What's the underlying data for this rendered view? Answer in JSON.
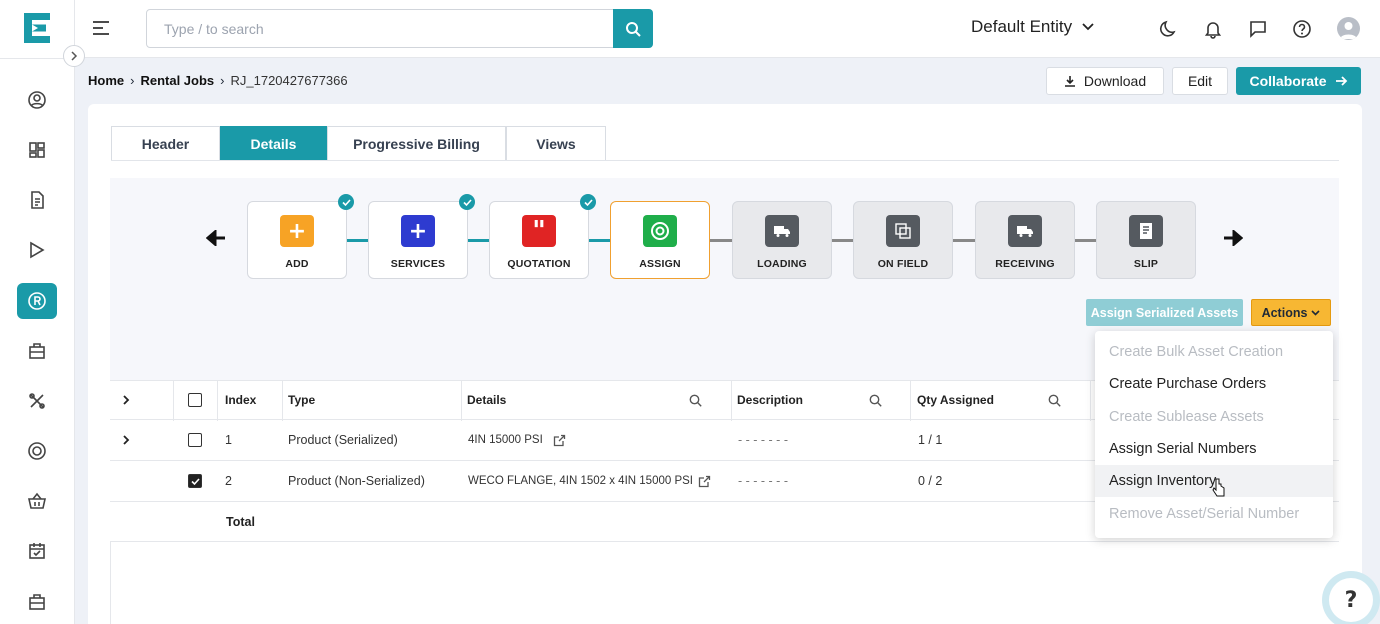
{
  "topbar": {
    "search_placeholder": "Type / to search",
    "entity": "Default Entity"
  },
  "breadcrumb": {
    "home": "Home",
    "section": "Rental Jobs",
    "current": "RJ_1720427677366"
  },
  "header_buttons": {
    "download": "Download",
    "edit": "Edit",
    "collaborate": "Collaborate"
  },
  "tabs": [
    {
      "label": "Header"
    },
    {
      "label": "Details"
    },
    {
      "label": "Progressive Billing"
    },
    {
      "label": "Views"
    }
  ],
  "workflow": {
    "steps": [
      {
        "label": "ADD",
        "state": "done",
        "icon": "plus-icon",
        "color": "#f7a325"
      },
      {
        "label": "SERVICES",
        "state": "done",
        "icon": "plus-icon",
        "color": "#2e3bd0"
      },
      {
        "label": "QUOTATION",
        "state": "done",
        "icon": "quote-icon",
        "color": "#e02424"
      },
      {
        "label": "ASSIGN",
        "state": "current",
        "icon": "assign-icon",
        "color": "#1fae4a"
      },
      {
        "label": "LOADING",
        "state": "pending",
        "icon": "truck-icon",
        "color": "#555a60"
      },
      {
        "label": "ON FIELD",
        "state": "pending",
        "icon": "field-icon",
        "color": "#555a60"
      },
      {
        "label": "RECEIVING",
        "state": "pending",
        "icon": "truck-icon",
        "color": "#555a60"
      },
      {
        "label": "SLIP",
        "state": "pending",
        "icon": "slip-icon",
        "color": "#555a60"
      }
    ]
  },
  "buttons": {
    "assign_serialized": "Assign Serialized Assets",
    "actions": "Actions"
  },
  "table": {
    "columns": [
      "Index",
      "Type",
      "Details",
      "Description",
      "Qty Assigned"
    ],
    "rows": [
      {
        "index": "1",
        "type": "Product (Serialized)",
        "details": "4IN 15000 PSI",
        "description": "- - - - - - -",
        "qty": "1 / 1",
        "checked": false
      },
      {
        "index": "2",
        "type": "Product (Non-Serialized)",
        "details": "WECO FLANGE, 4IN 1502 x 4IN 15000 PSI",
        "description": "- - - - - - -",
        "qty": "0 / 2",
        "checked": true
      }
    ],
    "total_label": "Total"
  },
  "actions_menu": [
    {
      "label": "Create Bulk Asset Creation",
      "disabled": true
    },
    {
      "label": "Create Purchase Orders",
      "disabled": false
    },
    {
      "label": "Create Sublease Assets",
      "disabled": true
    },
    {
      "label": "Assign Serial Numbers",
      "disabled": false
    },
    {
      "label": "Assign Inventory",
      "disabled": false,
      "hover": true
    },
    {
      "label": "Remove Asset/Serial Number",
      "disabled": true
    }
  ],
  "help": {
    "label": "?"
  },
  "colors": {
    "accent": "#1a9aa8",
    "actions": "#f7b733"
  }
}
